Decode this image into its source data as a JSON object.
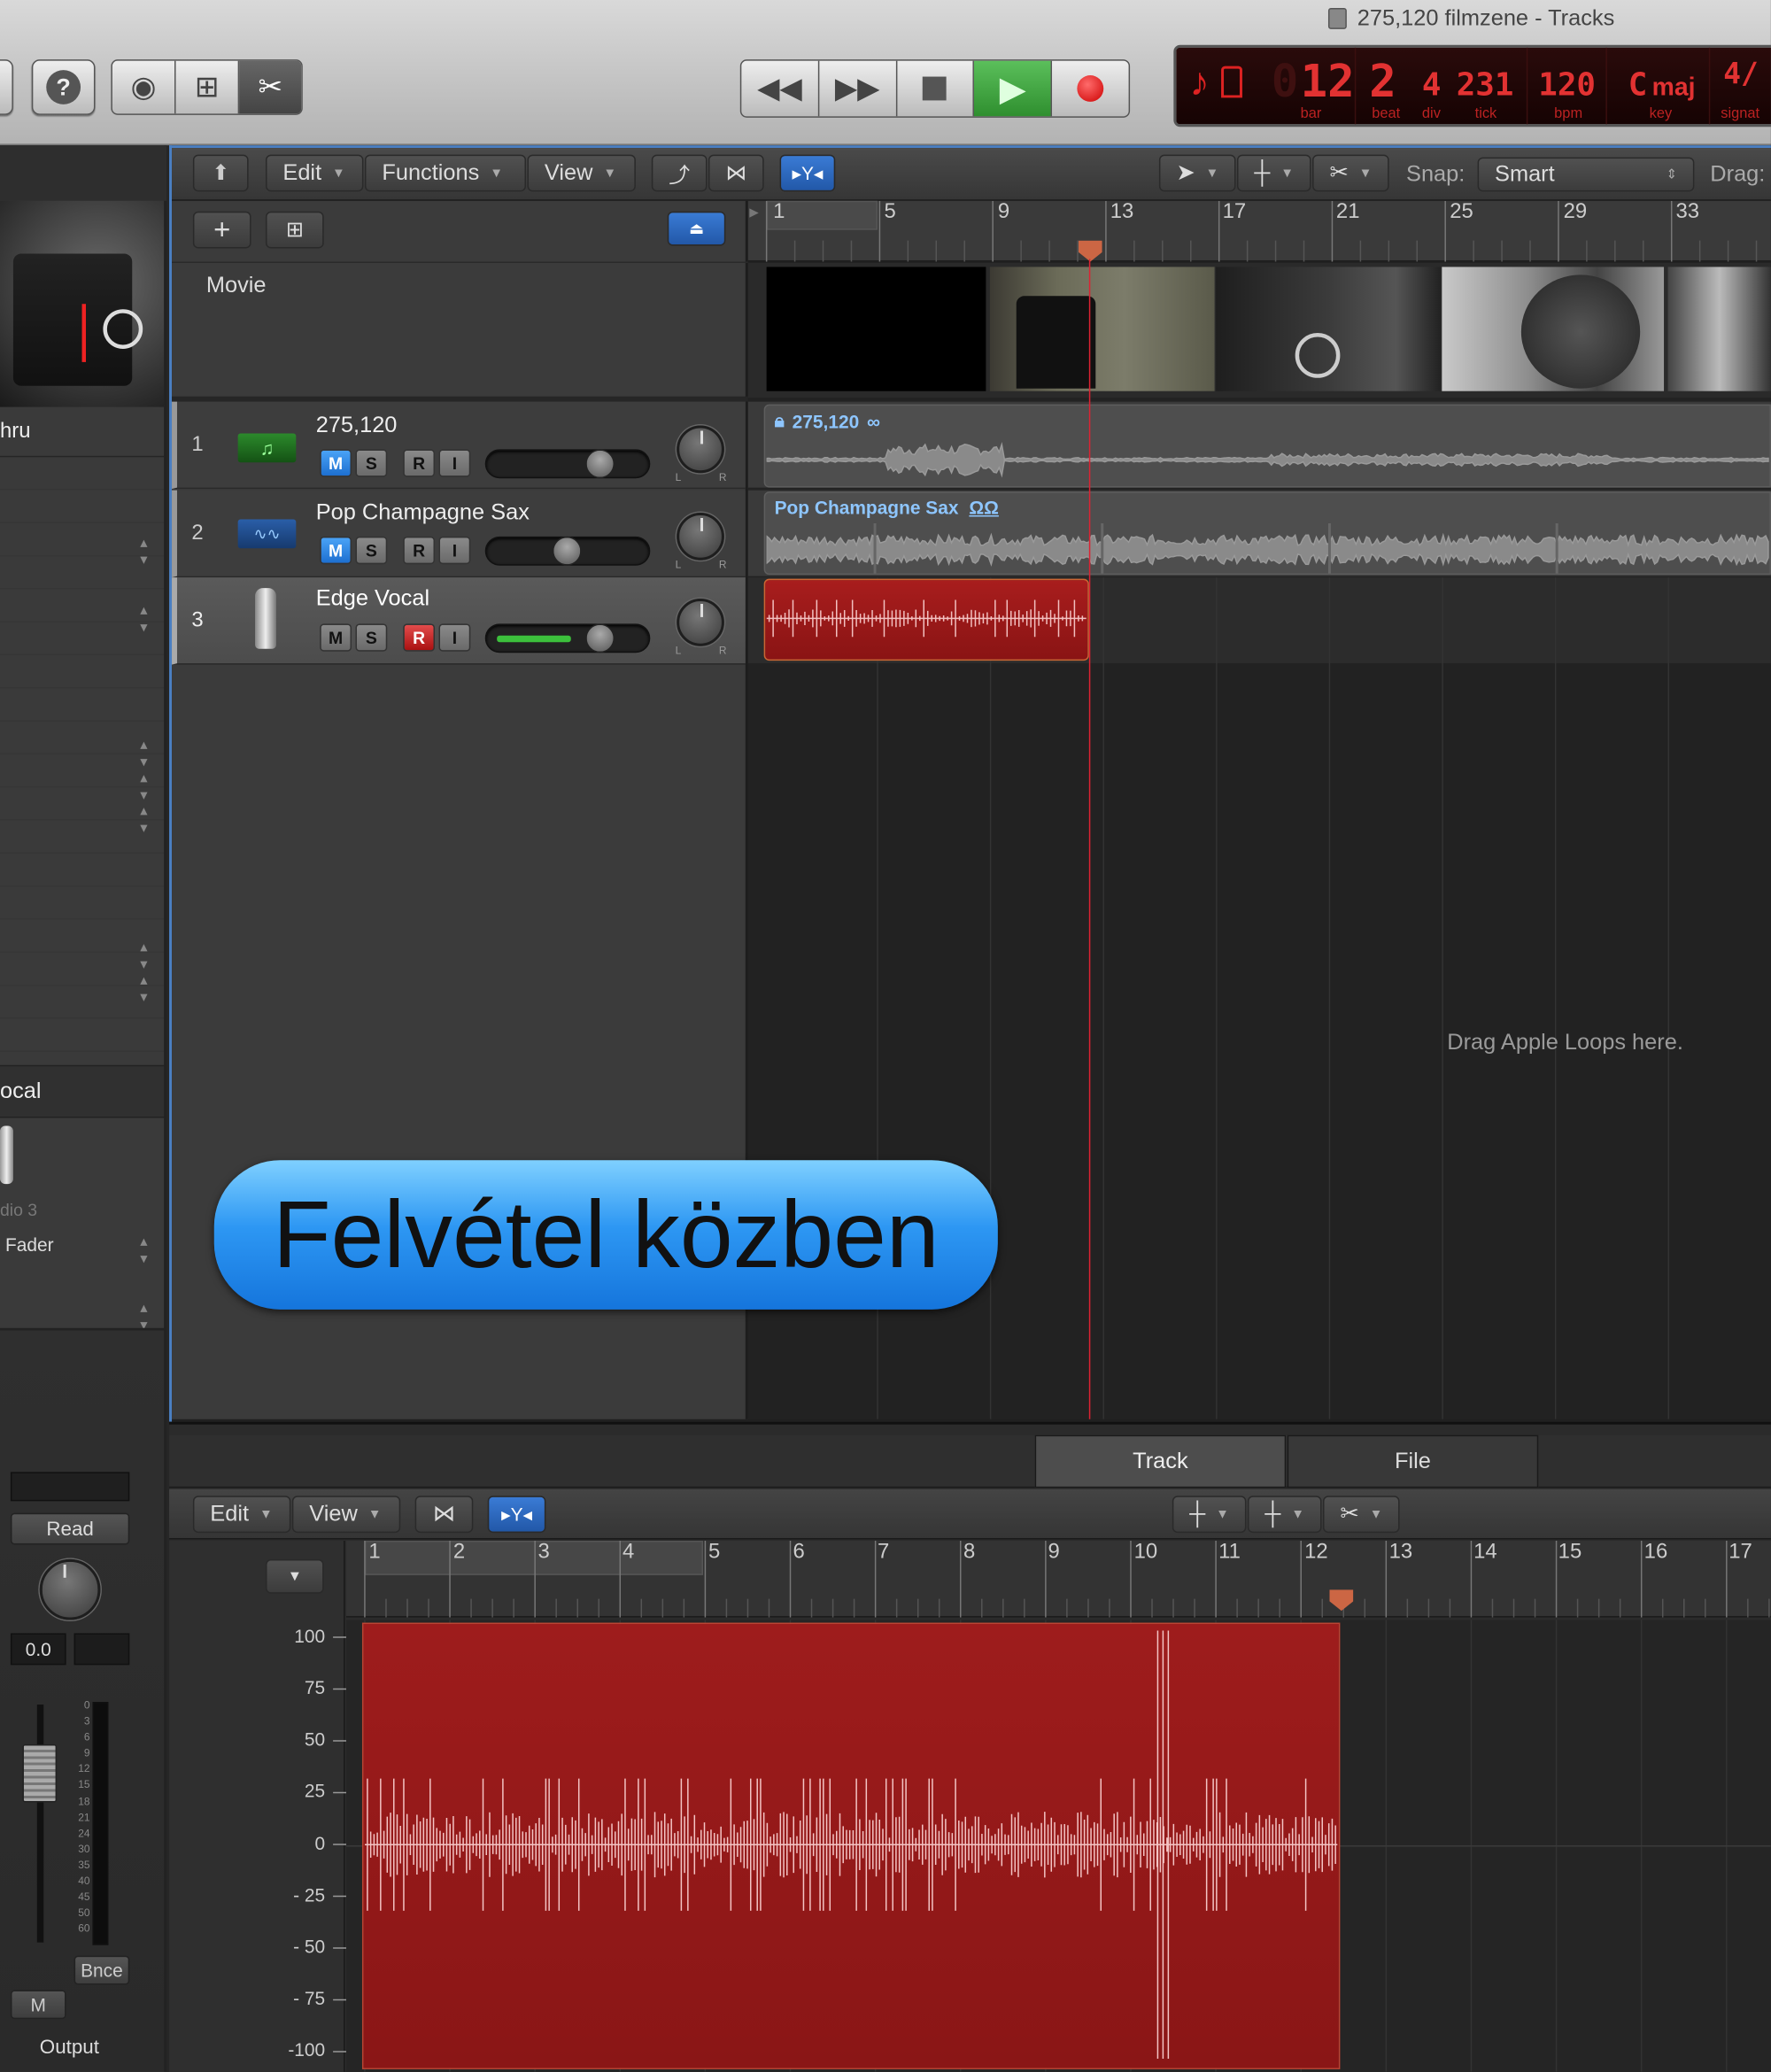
{
  "window": {
    "title": "275,120 filmzene - Tracks"
  },
  "control_bar": {
    "lcd": {
      "bar": "12",
      "bar_lead": "0",
      "bar_label": "bar",
      "beat": "2",
      "beat_label": "beat",
      "div": "4",
      "div_label": "div",
      "tick": "231",
      "tick_label": "tick",
      "bpm": "120",
      "bpm_label": "bpm",
      "key": "C",
      "key_mode": "maj",
      "key_label": "key",
      "signature": "4/",
      "signature_label": "signat"
    }
  },
  "tracks_menu": {
    "edit": "Edit",
    "functions": "Functions",
    "view": "View",
    "snap_label": "Snap:",
    "snap_value": "Smart",
    "drag_label": "Drag:"
  },
  "movie_track": {
    "label": "Movie"
  },
  "tracks": [
    {
      "number": "1",
      "name": "275,120",
      "m": "M",
      "s": "S",
      "r": "R",
      "i": "I",
      "region": "275,120",
      "fader": 0.75
    },
    {
      "number": "2",
      "name": "Pop Champagne Sax",
      "m": "M",
      "s": "S",
      "r": "R",
      "i": "I",
      "region": "Pop Champagne Sax",
      "fader": 0.5
    },
    {
      "number": "3",
      "name": "Edge Vocal",
      "m": "M",
      "s": "S",
      "r": "R",
      "i": "I",
      "region": "",
      "fader": 0.75
    }
  ],
  "ruler_top": [
    "1",
    "5",
    "9",
    "13",
    "17",
    "21",
    "25",
    "29",
    "33"
  ],
  "loops_hint": "Drag Apple Loops here.",
  "caption": "Felvétel közben",
  "inspector": {
    "track_label_partial": "hru",
    "channel_label_partial": "ocal",
    "audio_partial": "dio 3",
    "fader_label": "Fader",
    "automation": "Read",
    "volume": "0.0",
    "bounce": "Bnce",
    "mute": "M",
    "output": "Output",
    "meter_scale": [
      "0",
      "3",
      "6",
      "9",
      "12",
      "15",
      "18",
      "21",
      "24",
      "30",
      "35",
      "40",
      "45",
      "50",
      "60"
    ]
  },
  "editor": {
    "tab_track": "Track",
    "tab_file": "File",
    "edit": "Edit",
    "view": "View",
    "ruler": [
      "1",
      "2",
      "3",
      "4",
      "5",
      "6",
      "7",
      "8",
      "9",
      "10",
      "11",
      "12",
      "13",
      "14",
      "15",
      "16",
      "17"
    ],
    "amplitude_scale": [
      "100",
      "75",
      "50",
      "25",
      "0",
      "- 25",
      "- 50",
      "- 75",
      "-100"
    ]
  },
  "colors": {
    "accent_blue": "#1f84e6",
    "record_red": "#9c1a1a",
    "caption_blue": "#2e9cf5",
    "lcd_red": "#e23232"
  }
}
